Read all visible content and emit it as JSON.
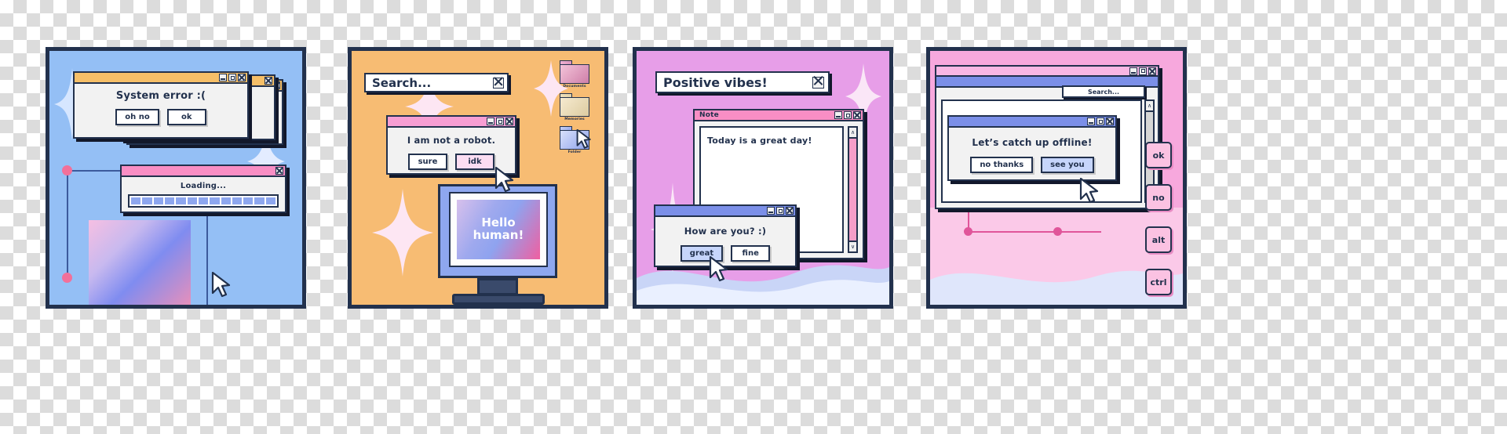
{
  "panels": [
    {
      "id": "system-error",
      "bg": "#94bff5",
      "windows": {
        "error": {
          "title": "",
          "titlebar_color": "#f6bf68",
          "message": "System error :(",
          "buttons": [
            "oh no",
            "ok"
          ]
        },
        "loading": {
          "titlebar_color": "#f98ec4",
          "message": "Loading...",
          "progress_blocks": 13
        }
      }
    },
    {
      "id": "not-a-robot",
      "bg": "#f7bc73",
      "search": {
        "value": "Search...",
        "close": "x"
      },
      "windows": {
        "robot": {
          "titlebar_color": "#f79ed3",
          "message": "I am not a robot.",
          "buttons": [
            "sure",
            "idk"
          ]
        }
      },
      "folders": [
        {
          "label": "Documents",
          "color": "pink"
        },
        {
          "label": "Memories",
          "color": "cream"
        },
        {
          "label": "Folder",
          "color": "blue"
        }
      ],
      "monitor": {
        "screen_text_line1": "Hello",
        "screen_text_line2": "human!"
      }
    },
    {
      "id": "positive-vibes",
      "bg": "#e79ee8",
      "header": {
        "title": "Positive vibes!"
      },
      "windows": {
        "note": {
          "title": "Note",
          "titlebar_color": "#f98ec4",
          "content": "Today is a great day!"
        },
        "mood": {
          "titlebar_color": "#7b8fe8",
          "message": "How are you? :)",
          "buttons": [
            "great",
            "fine"
          ]
        }
      }
    },
    {
      "id": "catch-up",
      "bg": "#f7a8dd",
      "search": {
        "value": "Search..."
      },
      "windows": {
        "catchup": {
          "titlebar_color": "#7b8fe8",
          "message": "Let’s catch up offline!",
          "buttons": [
            "no thanks",
            "see you"
          ]
        }
      },
      "keys": [
        "ok",
        "no",
        "alt",
        "ctrl"
      ]
    }
  ],
  "icons": {
    "minimize": "minimize-icon",
    "maximize": "maximize-icon",
    "close": "close-icon",
    "cursor": "mouse-cursor-icon",
    "sparkle": "sparkle-icon",
    "scroll_up": "∧",
    "scroll_down": "∨"
  },
  "colors": {
    "outline": "#22314d",
    "orange_titlebar": "#f6bf68",
    "pink_titlebar": "#f98ec4",
    "blue_titlebar": "#7b8fe8",
    "panel1_bg": "#94bff5",
    "panel2_bg": "#f7bc73",
    "panel3_bg": "#e79ee8",
    "panel4_bg": "#f7a8dd"
  }
}
